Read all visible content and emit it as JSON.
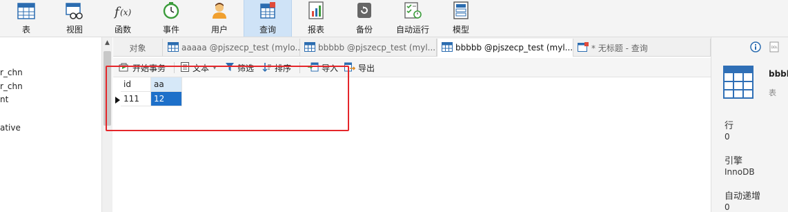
{
  "toolbar": {
    "items": [
      {
        "label": "表",
        "icon": "table-icon"
      },
      {
        "label": "视图",
        "icon": "view-icon"
      },
      {
        "label": "函数",
        "icon": "function-icon"
      },
      {
        "label": "事件",
        "icon": "event-clock-icon"
      },
      {
        "label": "用户",
        "icon": "user-icon"
      },
      {
        "label": "查询",
        "icon": "query-icon"
      },
      {
        "label": "报表",
        "icon": "report-icon"
      },
      {
        "label": "备份",
        "icon": "backup-icon"
      },
      {
        "label": "自动运行",
        "icon": "auto-run-icon"
      },
      {
        "label": "模型",
        "icon": "model-icon"
      }
    ],
    "active": "查询"
  },
  "navigator": {
    "items": [
      "r_chn",
      "r_chn",
      "nt",
      "ative"
    ]
  },
  "tabs": [
    {
      "label": "对象"
    },
    {
      "label": "aaaaa @pjszecp_test (mylo..."
    },
    {
      "label": "bbbbb @pjszecp_test (myl..."
    },
    {
      "label": "bbbbb @pjszecp_test (myl..."
    },
    {
      "label": "* 无标题 - 查询"
    }
  ],
  "subtoolbar": {
    "begin_transaction": "开始事务",
    "text": "文本",
    "filter": "筛选",
    "sort": "排序",
    "import": "导入",
    "export": "导出"
  },
  "grid": {
    "columns": [
      "id",
      "aa"
    ],
    "rows": [
      [
        "111",
        "12"
      ]
    ]
  },
  "info_panel": {
    "table_name": "bbbb",
    "table_type": "表",
    "fields": [
      {
        "key": "行",
        "value": "0"
      },
      {
        "key": "引擎",
        "value": "InnoDB"
      },
      {
        "key": "自动递增",
        "value": "0"
      }
    ]
  },
  "colors": {
    "accent": "#1e70c9",
    "highlight": "#e5262a",
    "active_tab": "#cfe3f7"
  }
}
